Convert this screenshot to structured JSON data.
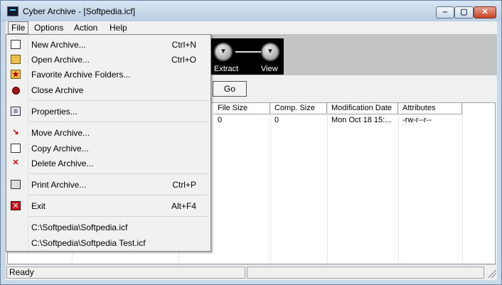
{
  "window": {
    "title": "Cyber Archive - [Softpedia.icf]",
    "buttons": {
      "minimize": "‒",
      "maximize": "▢",
      "close": "✕"
    }
  },
  "menubar": {
    "file": "File",
    "options": "Options",
    "action": "Action",
    "help": "Help"
  },
  "toolbar": {
    "extract_label": "Extract",
    "view_label": "View",
    "go_label": "Go"
  },
  "file_menu": {
    "new_archive": {
      "label": "New Archive...",
      "shortcut": "Ctrl+N"
    },
    "open_archive": {
      "label": "Open Archive...",
      "shortcut": "Ctrl+O"
    },
    "favorite_folders": {
      "label": "Favorite Archive Folders..."
    },
    "close_archive": {
      "label": "Close Archive"
    },
    "properties": {
      "label": "Properties..."
    },
    "move_archive": {
      "label": "Move Archive..."
    },
    "copy_archive": {
      "label": "Copy Archive..."
    },
    "delete_archive": {
      "label": "Delete Archive..."
    },
    "print_archive": {
      "label": "Print Archive...",
      "shortcut": "Ctrl+P"
    },
    "exit": {
      "label": "Exit",
      "shortcut": "Alt+F4"
    },
    "recent": [
      "C:\\Softpedia\\Softpedia.icf",
      "C:\\Softpedia\\Softpedia Test.icf"
    ]
  },
  "table": {
    "columns": [
      "File Size",
      "Comp. Size",
      "Modification Date",
      "Attributes"
    ],
    "rows": [
      {
        "file_size": "0",
        "comp_size": "0",
        "modified": "Mon Oct 18 15:...",
        "attributes": "-rw-r--r--"
      }
    ]
  },
  "status": {
    "text": "Ready"
  },
  "colors": {
    "title_bar": "#c8d9ea",
    "close_button": "#c5432b",
    "toolbar": "#c4c4c4",
    "menu": "#f1f1f1"
  }
}
